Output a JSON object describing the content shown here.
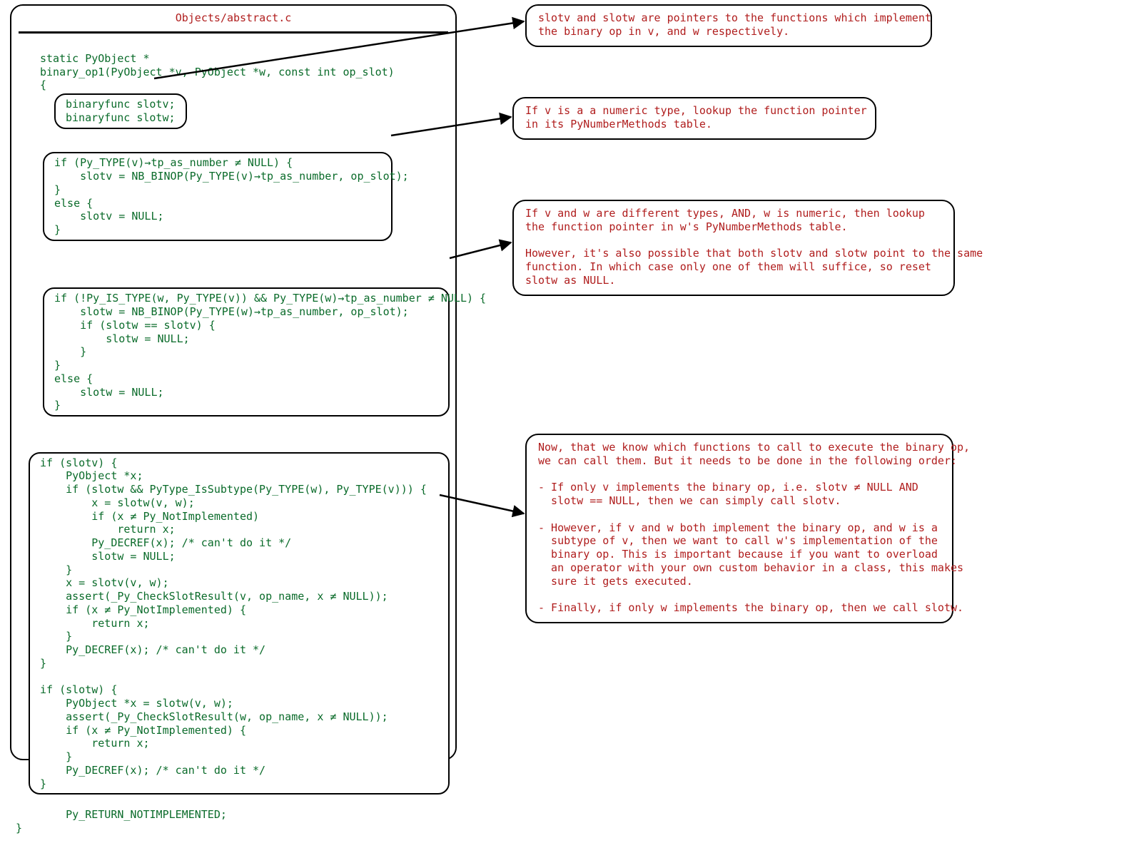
{
  "title": "Objects/abstract.c",
  "code": {
    "sig1": "static PyObject *",
    "sig2": "binary_op1(PyObject *v, PyObject *w, const int op_slot)",
    "open": "{",
    "block1": "binaryfunc slotv;\nbinaryfunc slotw;",
    "block2": "if (Py_TYPE(v)→tp_as_number ≠ NULL) {\n    slotv = NB_BINOP(Py_TYPE(v)→tp_as_number, op_slot);\n}\nelse {\n    slotv = NULL;\n}",
    "block3": "if (!Py_IS_TYPE(w, Py_TYPE(v)) && Py_TYPE(w)→tp_as_number ≠ NULL) {\n    slotw = NB_BINOP(Py_TYPE(w)→tp_as_number, op_slot);\n    if (slotw == slotv) {\n        slotw = NULL;\n    }\n}\nelse {\n    slotw = NULL;\n}",
    "block4": "if (slotv) {\n    PyObject *x;\n    if (slotw && PyType_IsSubtype(Py_TYPE(w), Py_TYPE(v))) {\n        x = slotw(v, w);\n        if (x ≠ Py_NotImplemented)\n            return x;\n        Py_DECREF(x); /* can't do it */\n        slotw = NULL;\n    }\n    x = slotv(v, w);\n    assert(_Py_CheckSlotResult(v, op_name, x ≠ NULL));\n    if (x ≠ Py_NotImplemented) {\n        return x;\n    }\n    Py_DECREF(x); /* can't do it */\n}\n\nif (slotw) {\n    PyObject *x = slotw(v, w);\n    assert(_Py_CheckSlotResult(w, op_name, x ≠ NULL));\n    if (x ≠ Py_NotImplemented) {\n        return x;\n    }\n    Py_DECREF(x); /* can't do it */\n}",
    "tail": "Py_RETURN_NOTIMPLEMENTED;",
    "close": "}"
  },
  "annotations": {
    "a1": "slotv and slotw are pointers to the functions which implement\nthe binary op in v, and w respectively.",
    "a2": "If v is a a numeric type, lookup the function pointer\nin its PyNumberMethods table.",
    "a3": "If v and w are different types, AND, w is numeric, then lookup\nthe function pointer in w's PyNumberMethods table.\n\nHowever, it's also possible that both slotv and slotw point to the same\nfunction. In which case only one of them will suffice, so reset\nslotw as NULL.",
    "a4": "Now, that we know which functions to call to execute the binary op,\nwe can call them. But it needs to be done in the following order:\n\n- If only v implements the binary op, i.e. slotv ≠ NULL AND\n  slotw == NULL, then we can simply call slotv.\n\n- However, if v and w both implement the binary op, and w is a\n  subtype of v, then we want to call w's implementation of the\n  binary op. This is important because if you want to overload\n  an operator with your own custom behavior in a class, this makes\n  sure it gets executed.\n\n- Finally, if only w implements the binary op, then we call slotw."
  }
}
